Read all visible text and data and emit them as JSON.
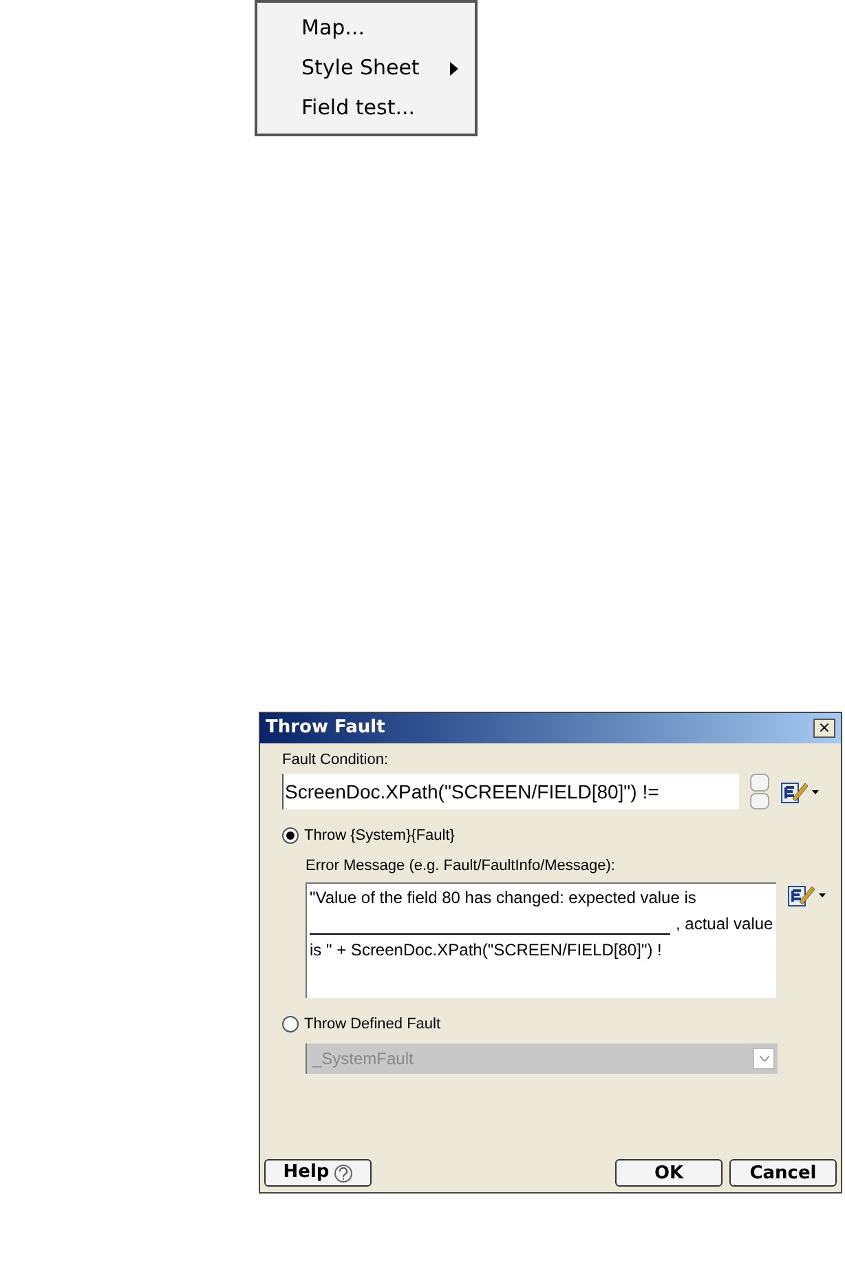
{
  "menu": {
    "items": [
      {
        "label": "Map...",
        "submenu": false
      },
      {
        "label": "Style Sheet",
        "submenu": true
      },
      {
        "label": "Field test...",
        "submenu": false
      }
    ]
  },
  "dialog": {
    "title": "Throw Fault",
    "condition": {
      "label": "Fault Condition:",
      "value": "ScreenDoc.XPath(\"SCREEN/FIELD[80]\") !="
    },
    "options": [
      {
        "label": "Throw {System}{Fault}",
        "selected": true
      },
      {
        "label": "Throw Defined Fault",
        "selected": false
      }
    ],
    "message": {
      "label": "Error Message (e.g. Fault/FaultInfo/Message):",
      "lines": [
        "\"Value of the field 80 has changed: expected value is",
        ", actual value",
        "is \" + ScreenDoc.XPath(\"SCREEN/FIELD[80]\") !"
      ]
    },
    "fault_select": {
      "value": "_SystemFault",
      "disabled": true
    },
    "buttons": {
      "help": "Help",
      "ok": "OK",
      "cancel": "Cancel",
      "close": "×"
    }
  }
}
